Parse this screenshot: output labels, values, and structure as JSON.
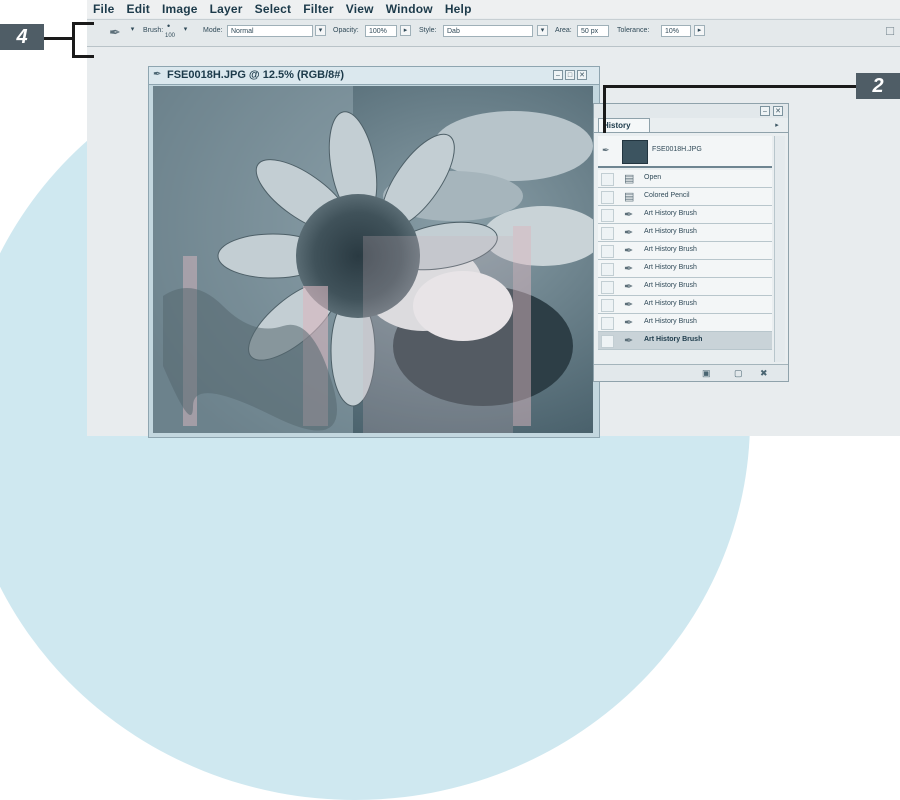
{
  "menubar": {
    "items": [
      "File",
      "Edit",
      "Image",
      "Layer",
      "Select",
      "Filter",
      "View",
      "Window",
      "Help"
    ]
  },
  "options_bar": {
    "tool_icon": "art-history-brush-icon",
    "brush_label": "Brush:",
    "brush_size": "100",
    "mode_label": "Mode:",
    "mode_value": "Normal",
    "opacity_label": "Opacity:",
    "opacity_value": "100%",
    "style_label": "Style:",
    "style_value": "Dab",
    "area_label": "Area:",
    "area_value": "50 px",
    "tolerance_label": "Tolerance:",
    "tolerance_value": "10%"
  },
  "document": {
    "title": "FSE0018H.JPG @ 12.5% (RGB/8#)"
  },
  "history_panel": {
    "tab_label": "History",
    "snapshot_label": "FSE0018H.JPG",
    "items": [
      {
        "label": "Open",
        "icon": "document-icon"
      },
      {
        "label": "Colored Pencil",
        "icon": "document-icon"
      },
      {
        "label": "Art History Brush",
        "icon": "art-history-brush-icon"
      },
      {
        "label": "Art History Brush",
        "icon": "art-history-brush-icon"
      },
      {
        "label": "Art History Brush",
        "icon": "art-history-brush-icon"
      },
      {
        "label": "Art History Brush",
        "icon": "art-history-brush-icon"
      },
      {
        "label": "Art History Brush",
        "icon": "art-history-brush-icon"
      },
      {
        "label": "Art History Brush",
        "icon": "art-history-brush-icon"
      },
      {
        "label": "Art History Brush",
        "icon": "art-history-brush-icon"
      },
      {
        "label": "Art History Brush",
        "icon": "art-history-brush-icon"
      }
    ]
  },
  "callouts": {
    "left": "4",
    "right": "2"
  },
  "colors": {
    "callout_bg": "#4f5d66",
    "accent_bg": "#cfe8f0"
  }
}
